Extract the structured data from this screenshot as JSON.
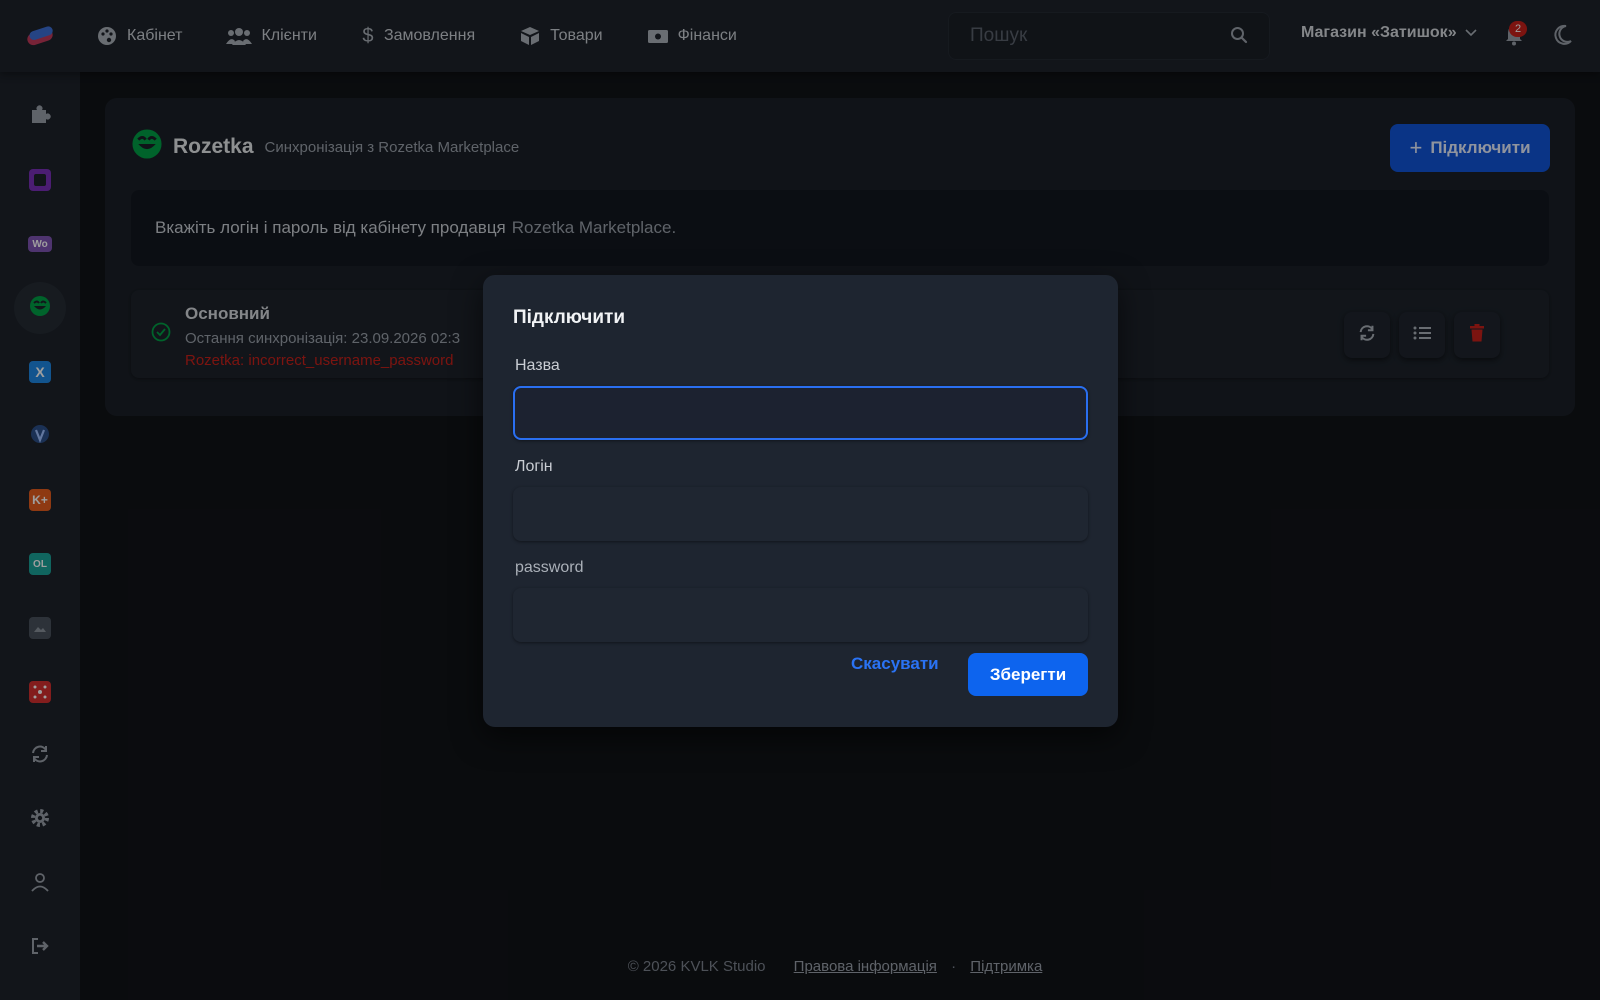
{
  "nav": {
    "items": [
      {
        "label": "Кабінет",
        "icon": "palette-icon"
      },
      {
        "label": "Клієнти",
        "icon": "users-icon"
      },
      {
        "label": "Замовлення",
        "icon": "dollar-icon"
      },
      {
        "label": "Товари",
        "icon": "box-icon"
      },
      {
        "label": "Фінанси",
        "icon": "money-icon"
      }
    ]
  },
  "search": {
    "placeholder": "Пошук"
  },
  "header": {
    "store_name": "Магазин «Затишок»",
    "notification_count": "2"
  },
  "sidebar": {
    "items": [
      {
        "icon": "puzzle-icon",
        "color": "#9aa1aa"
      },
      {
        "icon": "square-app-icon",
        "color": "#7a2fb8"
      },
      {
        "icon": "woo-icon",
        "color": "#7f54b3"
      },
      {
        "icon": "rozetka-icon",
        "color": "#00a046"
      },
      {
        "icon": "x-icon",
        "color": "#1e88e5"
      },
      {
        "icon": "shield-v-icon",
        "color": "#4a7bd0"
      },
      {
        "icon": "k-plus-icon",
        "color": "#e65c1e"
      },
      {
        "icon": "olx-icon",
        "color": "#1aa39a"
      },
      {
        "icon": "gallery-icon",
        "color": "#6b7480"
      },
      {
        "icon": "network-icon",
        "color": "#d32f2f"
      },
      {
        "icon": "sync-icon",
        "color": "#9aa1aa"
      },
      {
        "icon": "gear-icon",
        "color": "#9aa1aa"
      },
      {
        "icon": "user-icon",
        "color": "#9aa1aa"
      },
      {
        "icon": "logout-icon",
        "color": "#9aa1aa"
      }
    ]
  },
  "card": {
    "title": "Rozetka",
    "subtitle": "Синхронізація з Rozetka Marketplace",
    "connect_label": "Підключити",
    "notice_text": "Вкажіть логін і пароль від кабінету продавця",
    "notice_highlight": "Rozetka Marketplace."
  },
  "account": {
    "name": "Основний",
    "last_sync": "Остання синхронізація: 23.09.2026 02:3",
    "error": "Rozetka: incorrect_username_password"
  },
  "modal": {
    "title": "Підключити",
    "name_label": "Назва",
    "login_label": "Логін",
    "password_label": "password",
    "cancel_label": "Скасувати",
    "save_label": "Зберегти"
  },
  "footer": {
    "copyright": "© 2026 KVLK Studio",
    "legal": "Правова інформація",
    "separator": "·",
    "support": "Підтримка"
  },
  "colors": {
    "accent": "#0d64ee",
    "error": "#c8211b",
    "success": "#00a046"
  }
}
